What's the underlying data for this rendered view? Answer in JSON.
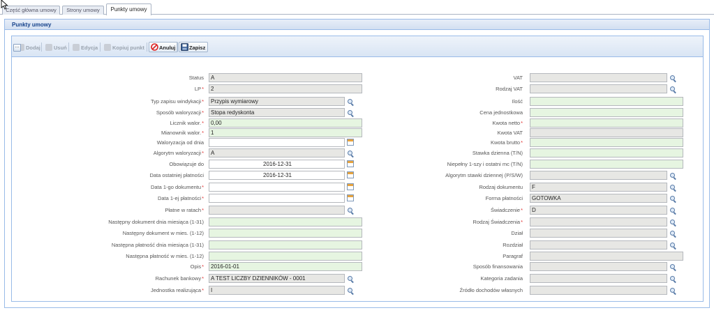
{
  "tabs": [
    {
      "label": "Część główna umowy"
    },
    {
      "label": "Strony umowy"
    },
    {
      "label": "Punkty umowy"
    }
  ],
  "panel": {
    "title": "Punkty umowy"
  },
  "toolbar": {
    "add": "Dodaj",
    "delete": "Usuń",
    "edit": "Edycja",
    "copy": "Kopiuj punkt",
    "cancel": "Anuluj",
    "save": "Zapisz"
  },
  "more_button": "...",
  "left_fields": [
    {
      "label": "Status",
      "value": "A",
      "required": false,
      "style": "grey",
      "trigger": "none"
    },
    {
      "label": "LP",
      "value": "2",
      "required": true,
      "style": "grey",
      "trigger": "none"
    },
    {
      "label": "Typ zapisu windykacji",
      "value": "Przypis wymiarowy",
      "required": true,
      "style": "grey",
      "trigger": "search"
    },
    {
      "label": "Sposób waloryzacji",
      "value": "Stopa redyskonta",
      "required": true,
      "style": "grey",
      "trigger": "search"
    },
    {
      "label": "Licznik walor.",
      "value": "0,00",
      "required": true,
      "style": "green",
      "trigger": "none"
    },
    {
      "label": "Mianownik walor.",
      "value": "1",
      "required": true,
      "style": "green",
      "trigger": "none"
    },
    {
      "label": "Waloryzacja od dnia",
      "value": "",
      "required": false,
      "style": "white",
      "trigger": "date"
    },
    {
      "label": "Algorytm waloryzacji",
      "value": "A",
      "required": true,
      "style": "grey",
      "trigger": "search"
    },
    {
      "label": "Obowiązuje do",
      "value": "2016-12-31",
      "required": false,
      "style": "white",
      "trigger": "date",
      "center": true
    },
    {
      "label": "Data ostatniej płatności",
      "value": "2016-12-31",
      "required": false,
      "style": "white",
      "trigger": "date",
      "center": true
    },
    {
      "label": "Data 1-go dokumentu",
      "value": "",
      "required": true,
      "style": "white",
      "trigger": "date"
    },
    {
      "label": "Data 1-ej płatności",
      "value": "",
      "required": true,
      "style": "white",
      "trigger": "date"
    },
    {
      "label": "Płatne w ratach",
      "value": "",
      "required": true,
      "style": "grey",
      "trigger": "search"
    },
    {
      "label": "Następny dokument dnia miesiąca (1-31)",
      "value": "",
      "required": false,
      "style": "green",
      "trigger": "none"
    },
    {
      "label": "Następny dokument w mies. (1-12)",
      "value": "",
      "required": false,
      "style": "green",
      "trigger": "none"
    },
    {
      "label": "Następna płatność dnia miesiąca (1-31)",
      "value": "",
      "required": false,
      "style": "green",
      "trigger": "none"
    },
    {
      "label": "Następna płatność w mies. (1-12)",
      "value": "",
      "required": false,
      "style": "green",
      "trigger": "none"
    },
    {
      "label": "Opis",
      "value": "2016-01-01",
      "required": true,
      "style": "green",
      "trigger": "none"
    },
    {
      "label": "Rachunek bankowy",
      "value": "A TEST LICZBY DZIENNIKÓW - 0001",
      "required": true,
      "style": "grey",
      "trigger": "search"
    },
    {
      "label": "Jednostka realizująca",
      "value": "I",
      "required": true,
      "style": "grey",
      "trigger": "search"
    }
  ],
  "right_fields": [
    {
      "label": "VAT",
      "value": "",
      "required": false,
      "style": "grey",
      "trigger": "search"
    },
    {
      "label": "Rodzaj VAT",
      "value": "",
      "required": false,
      "style": "grey",
      "trigger": "search"
    },
    {
      "label": "Ilość",
      "value": "",
      "required": false,
      "style": "green",
      "trigger": "none"
    },
    {
      "label": "Cena jednostkowa",
      "value": "",
      "required": false,
      "style": "green",
      "trigger": "none"
    },
    {
      "label": "Kwota netto",
      "value": "",
      "required": true,
      "style": "green",
      "trigger": "none"
    },
    {
      "label": "Kwota VAT",
      "value": "",
      "required": false,
      "style": "grey",
      "trigger": "none"
    },
    {
      "label": "Kwota brutto",
      "value": "",
      "required": true,
      "style": "green",
      "trigger": "none"
    },
    {
      "label": "Stawka dzienna (T/N)",
      "value": "",
      "required": false,
      "style": "green",
      "trigger": "none"
    },
    {
      "label": "Niepełny 1-szy i ostatni mc (T/N)",
      "value": "",
      "required": false,
      "style": "green",
      "trigger": "none"
    },
    {
      "label": "Algorytm stawki dziennej (P/S/W)",
      "value": "",
      "required": false,
      "style": "grey",
      "trigger": "search"
    },
    {
      "label": "Rodzaj dokumentu",
      "value": "F",
      "required": false,
      "style": "grey",
      "trigger": "search"
    },
    {
      "label": "Forma płatności",
      "value": "GOTOWKA",
      "required": false,
      "style": "grey",
      "trigger": "search"
    },
    {
      "label": "Świadczenie",
      "value": "D",
      "required": true,
      "style": "grey",
      "trigger": "search"
    },
    {
      "label": "Rodzaj Świadczenia",
      "value": "",
      "required": true,
      "style": "grey",
      "trigger": "search"
    },
    {
      "label": "Dział",
      "value": "",
      "required": false,
      "style": "grey",
      "trigger": "search"
    },
    {
      "label": "Rozdział",
      "value": "",
      "required": false,
      "style": "grey",
      "trigger": "search"
    },
    {
      "label": "Paragraf",
      "value": "",
      "required": false,
      "style": "grey",
      "trigger": "none"
    },
    {
      "label": "Sposób finansowania",
      "value": "",
      "required": false,
      "style": "grey",
      "trigger": "search"
    },
    {
      "label": "Kategoria zadania",
      "value": "",
      "required": false,
      "style": "grey",
      "trigger": "search"
    },
    {
      "label": "Źródło dochodów własnych",
      "value": "",
      "required": false,
      "style": "grey",
      "trigger": "search"
    }
  ]
}
